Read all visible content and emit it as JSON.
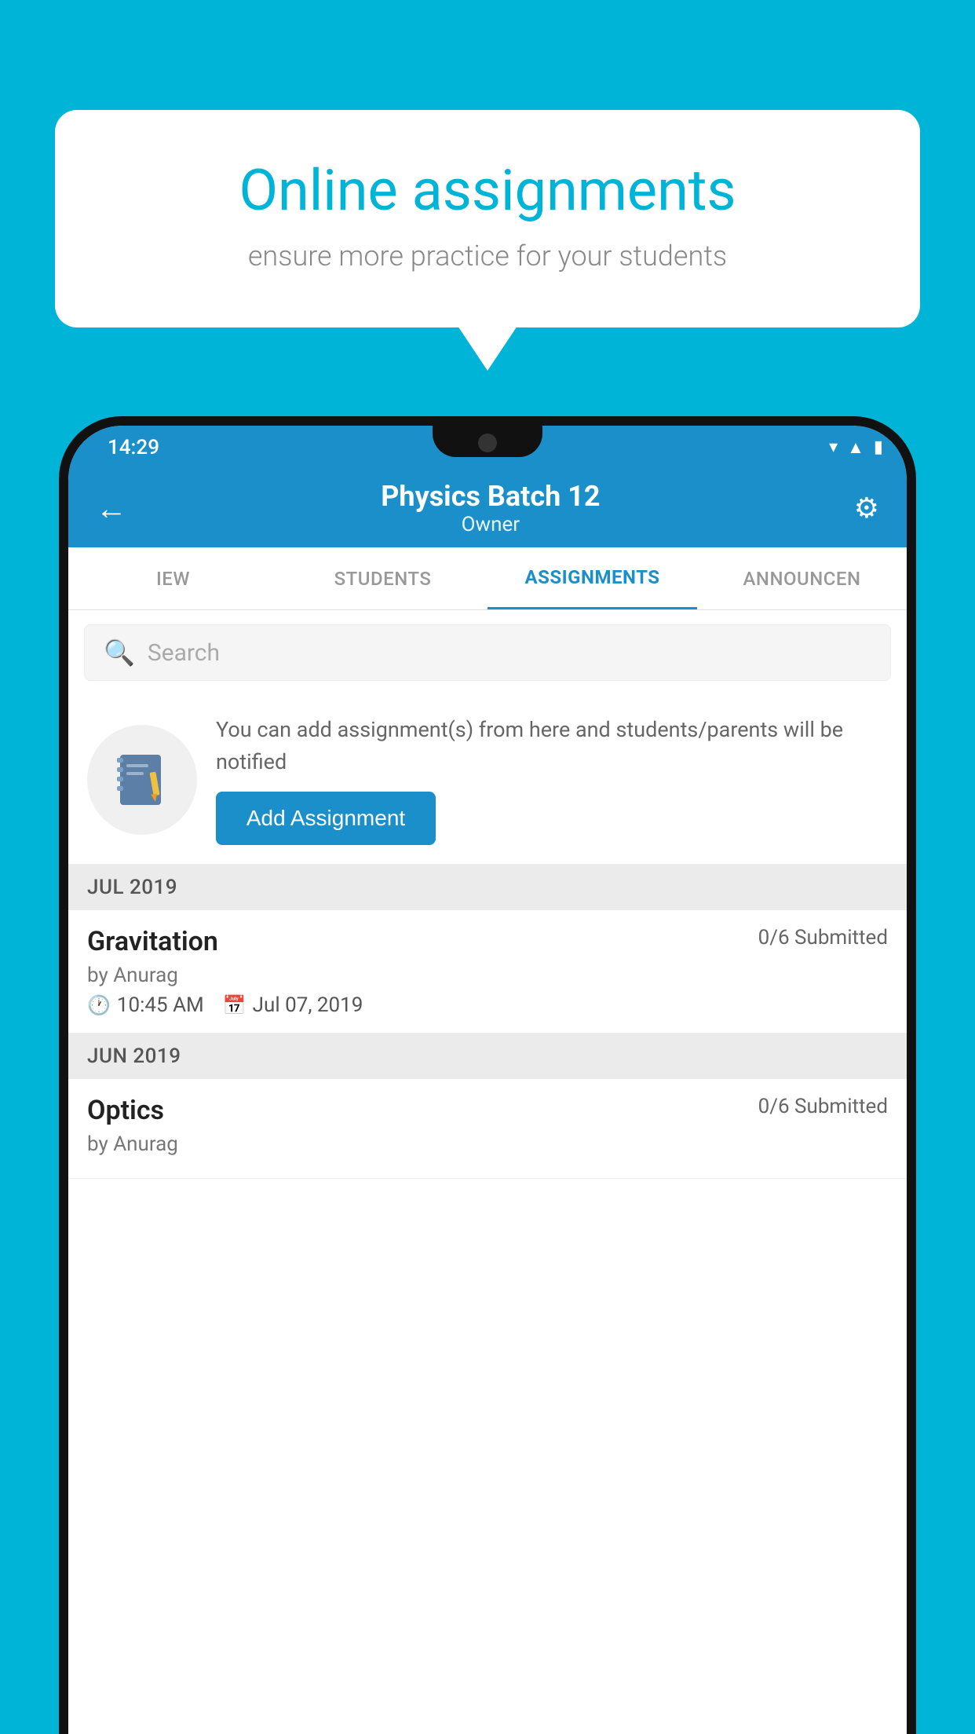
{
  "background": {
    "color": "#00b4d8"
  },
  "speech_bubble": {
    "title": "Online assignments",
    "subtitle": "ensure more practice for your students"
  },
  "status_bar": {
    "time": "14:29"
  },
  "app_header": {
    "title": "Physics Batch 12",
    "subtitle": "Owner",
    "back_label": "←",
    "settings_label": "⚙"
  },
  "tabs": [
    {
      "label": "IEW",
      "active": false
    },
    {
      "label": "STUDENTS",
      "active": false
    },
    {
      "label": "ASSIGNMENTS",
      "active": true
    },
    {
      "label": "ANNOUNCEN",
      "active": false
    }
  ],
  "search": {
    "placeholder": "Search"
  },
  "promo": {
    "text": "You can add assignment(s) from here and students/parents will be notified",
    "button_label": "Add Assignment"
  },
  "sections": [
    {
      "label": "JUL 2019",
      "assignments": [
        {
          "name": "Gravitation",
          "submitted": "0/6 Submitted",
          "author": "by Anurag",
          "time": "10:45 AM",
          "date": "Jul 07, 2019"
        }
      ]
    },
    {
      "label": "JUN 2019",
      "assignments": [
        {
          "name": "Optics",
          "submitted": "0/6 Submitted",
          "author": "by Anurag",
          "time": "",
          "date": ""
        }
      ]
    }
  ]
}
